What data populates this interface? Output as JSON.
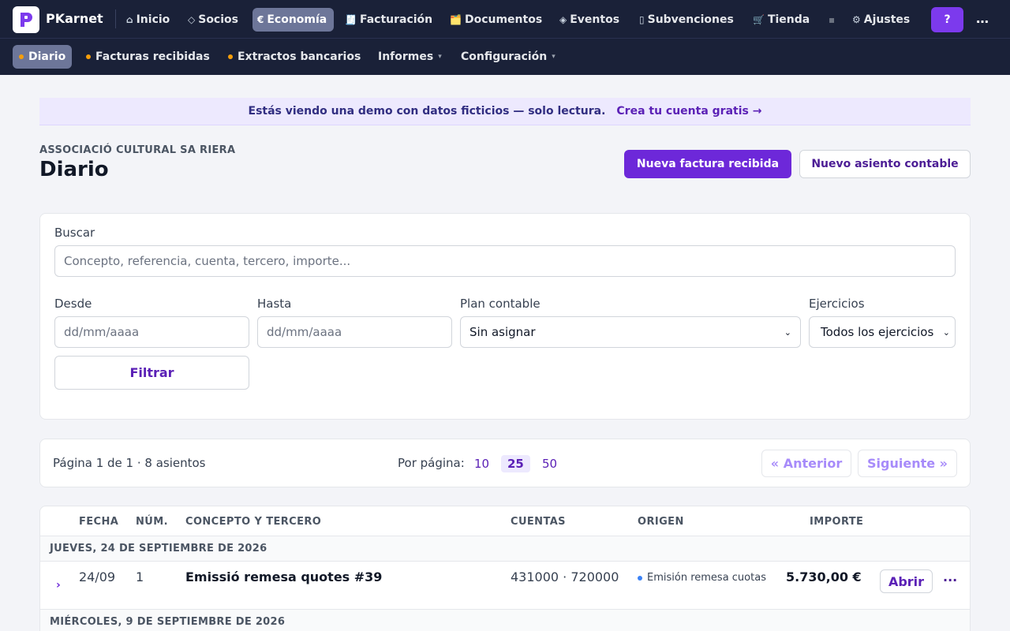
{
  "app": {
    "brand": "PKarnet"
  },
  "nav": {
    "items": [
      {
        "icon": "⌂",
        "label": "Inicio"
      },
      {
        "icon": "◇",
        "label": "Socios"
      },
      {
        "icon": "€",
        "label": "Economía"
      },
      {
        "icon": "🧾",
        "label": "Facturación"
      },
      {
        "icon": "🗂️",
        "label": "Documentos"
      },
      {
        "icon": "◈",
        "label": "Eventos"
      },
      {
        "icon": "▯",
        "label": "Subvenciones"
      },
      {
        "icon": "🛒",
        "label": "Tienda"
      },
      {
        "icon": "▪",
        "label": ""
      },
      {
        "icon": "⚙",
        "label": "Ajustes"
      }
    ],
    "help": "?",
    "more": "…"
  },
  "subnav": {
    "items": [
      "Diario",
      "Facturas recibidas",
      "Extractos bancarios",
      "Informes",
      "Configuración"
    ]
  },
  "banner": {
    "text": "Estás viendo una demo con datos ficticios — solo lectura.",
    "link": "Crea tu cuenta gratis →"
  },
  "header": {
    "org": "ASSOCIACIÓ CULTURAL SA RIERA",
    "title": "Diario",
    "primary_button": "Nueva factura recibida",
    "secondary_button": "Nuevo asiento contable"
  },
  "filters": {
    "search_label": "Buscar",
    "search_placeholder": "Concepto, referencia, cuenta, tercero, importe...",
    "from_label": "Desde",
    "from_placeholder": "dd/mm/aaaa",
    "to_label": "Hasta",
    "to_placeholder": "dd/mm/aaaa",
    "plan_label": "Plan contable",
    "plan_value": "Sin asignar",
    "years_label": "Ejercicios",
    "years_value": "Todos los ejercicios",
    "filter_button": "Filtrar"
  },
  "pagination": {
    "info": "Página 1 de 1 · 8 asientos",
    "per_page_label": "Por página:",
    "options": [
      "10",
      "25",
      "50"
    ],
    "selected": "25",
    "prev": "« Anterior",
    "next": "Siguiente »"
  },
  "table": {
    "columns": [
      "FECHA",
      "NÚM.",
      "CONCEPTO Y TERCERO",
      "CUENTAS",
      "ORIGEN",
      "IMPORTE"
    ],
    "groups": [
      {
        "date_label": "JUEVES, 24 DE SEPTIEMBRE DE 2026",
        "rows": [
          {
            "date": "24/09",
            "num": "1",
            "concept": "Emissió remesa quotes #39",
            "accounts": "431000 · 720000",
            "origin": "Emisión remesa cuotas",
            "amount": "5.730,00 €",
            "open": "Abrir",
            "more": "···"
          }
        ]
      },
      {
        "date_label": "MIÉRCOLES, 9 DE SEPTIEMBRE DE 2026",
        "rows": []
      }
    ]
  },
  "colors": {
    "nav_bg": "#1a2138",
    "accent": "#6d28d9",
    "banner_bg": "#ede9fe"
  }
}
